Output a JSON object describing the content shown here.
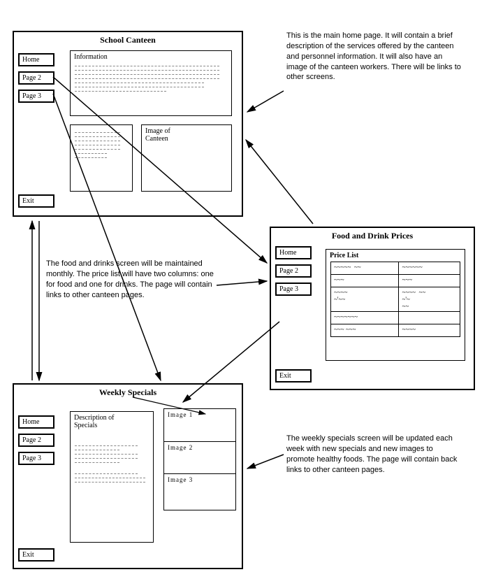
{
  "nav": {
    "home": "Home",
    "page2": "Page 2",
    "page3": "Page 3",
    "exit": "Exit"
  },
  "wireframes": {
    "home": {
      "title": "School Canteen",
      "info_label": "Information",
      "image_label": "Image of Canteen"
    },
    "prices": {
      "title": "Food and  Drink  Prices",
      "list_label": "Price List"
    },
    "specials": {
      "title": "Weekly Specials",
      "desc_label": "Description of Specials",
      "img1": "Image 1",
      "img2": "Image 2",
      "img3": "Image 3"
    }
  },
  "captions": {
    "home": "This is the main home page.  It will contain a brief description of the services offered by the canteen and personnel information.  It will also have an image of the canteen workers.  There will be links to other screens.",
    "prices": "The food and drinks screen will be maintained monthly.  The price list will have two columns: one for food and one for drinks. The page will contain links to other canteen pages.",
    "specials": "The weekly specials screen will be updated each week with new specials and new images to promote healthy foods.  The page will contain back links to other canteen pages."
  }
}
